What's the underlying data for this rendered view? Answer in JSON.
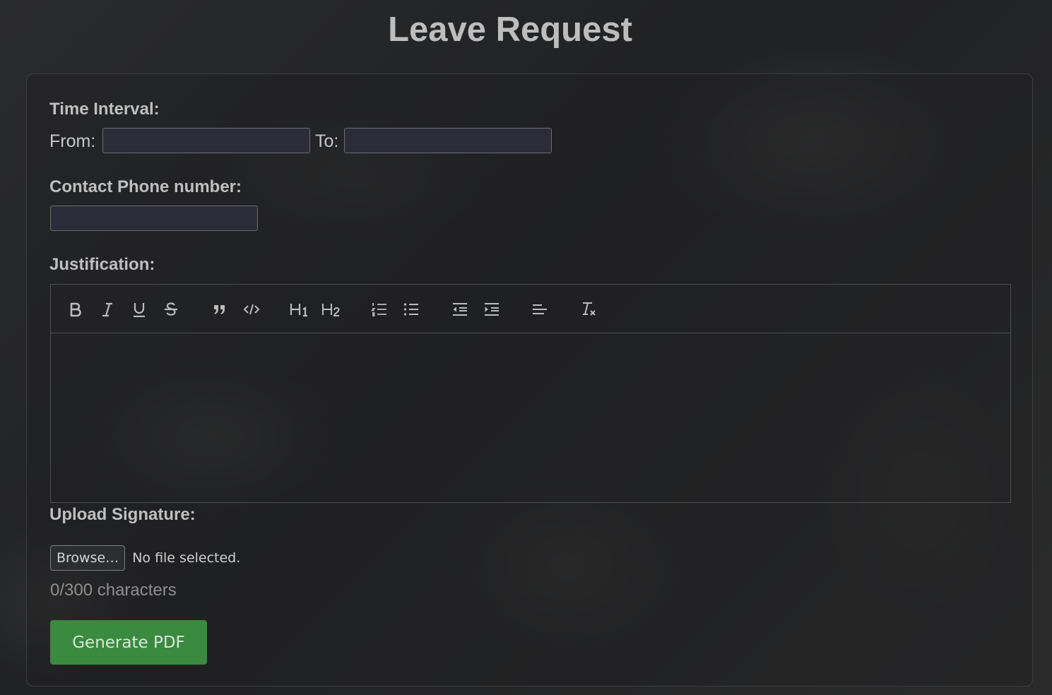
{
  "page": {
    "title": "Leave Request"
  },
  "form": {
    "time_interval_label": "Time Interval:",
    "from_label": "From:",
    "from_value": "",
    "to_label": "To:",
    "to_value": "",
    "phone_label": "Contact Phone number:",
    "phone_value": "",
    "justification_label": "Justification:",
    "justification_value": "",
    "signature_label": "Upload Signature:",
    "browse_label": "Browse…",
    "file_status": "No file selected.",
    "char_count": "0/300 characters",
    "submit_label": "Generate PDF"
  },
  "editor_toolbar": [
    {
      "name": "bold-button",
      "icon": "bold-icon"
    },
    {
      "name": "italic-button",
      "icon": "italic-icon"
    },
    {
      "name": "underline-button",
      "icon": "underline-icon"
    },
    {
      "name": "strikethrough-button",
      "icon": "strikethrough-icon"
    },
    {
      "name": "blockquote-button",
      "icon": "quote-icon"
    },
    {
      "name": "code-block-button",
      "icon": "code-icon"
    },
    {
      "name": "heading-1-button",
      "icon": "heading-1-icon"
    },
    {
      "name": "heading-2-button",
      "icon": "heading-2-icon"
    },
    {
      "name": "ordered-list-button",
      "icon": "ordered-list-icon"
    },
    {
      "name": "bullet-list-button",
      "icon": "bullet-list-icon"
    },
    {
      "name": "outdent-button",
      "icon": "outdent-icon"
    },
    {
      "name": "indent-button",
      "icon": "indent-icon"
    },
    {
      "name": "align-button",
      "icon": "align-left-icon"
    },
    {
      "name": "clear-format-button",
      "icon": "clear-format-icon"
    }
  ],
  "colors": {
    "background": "#232426",
    "input_background": "#2b2c37",
    "primary_button": "#3a8a3f",
    "text": "#c9c9c9",
    "muted_text": "#8f8f8f"
  }
}
